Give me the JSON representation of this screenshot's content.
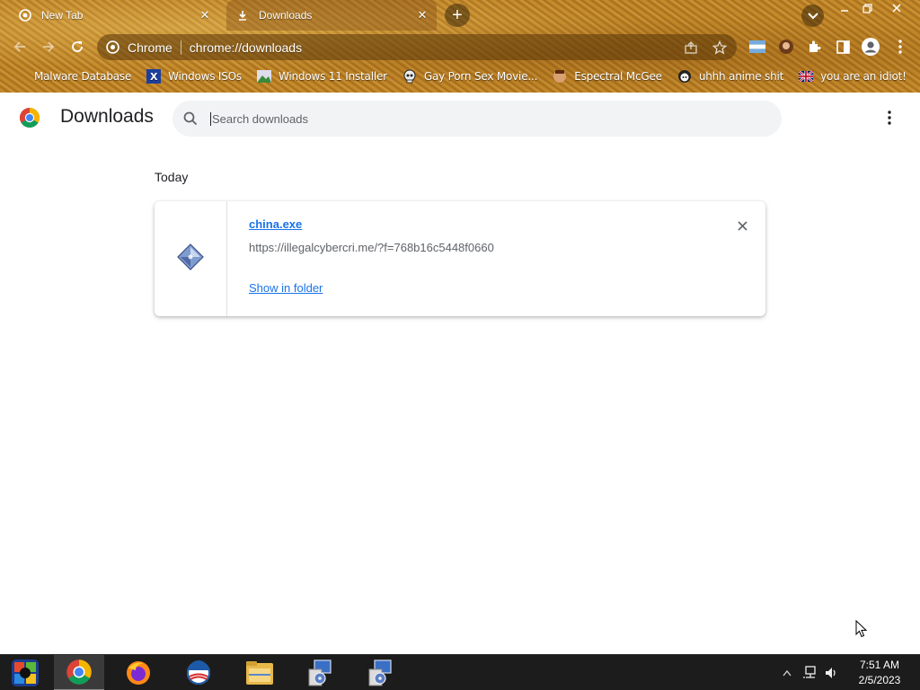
{
  "window": {
    "tabs": [
      {
        "label": "New Tab",
        "icon": "chrome-icon",
        "active": false
      },
      {
        "label": "Downloads",
        "icon": "download-icon",
        "active": true
      }
    ],
    "controls": [
      "minimize",
      "restore",
      "close"
    ]
  },
  "toolbar": {
    "omnibox_site": "Chrome",
    "omnibox_url": "chrome://downloads"
  },
  "bookmarks": [
    {
      "label": "Malware Database",
      "icon": "none"
    },
    {
      "label": "Windows ISOs",
      "icon": "x-icon"
    },
    {
      "label": "Windows 11 Installer",
      "icon": "image-icon"
    },
    {
      "label": "Gay Porn Sex Movie...",
      "icon": "skull-icon"
    },
    {
      "label": "Espectral McGee",
      "icon": "face-icon"
    },
    {
      "label": "uhhh anime shit",
      "icon": "anime-icon"
    },
    {
      "label": "you are an idiot!",
      "icon": "flag-icon"
    }
  ],
  "page": {
    "title": "Downloads",
    "search_placeholder": "Search downloads",
    "date_header": "Today",
    "downloads": [
      {
        "file_name": "china.exe",
        "url": "https://illegalcybercri.me/?f=768b16c5448f0660",
        "action": "Show in folder"
      }
    ]
  },
  "taskbar": {
    "items": [
      "start-orb",
      "chrome",
      "firefox",
      "obama-app",
      "file-explorer",
      "installer-1",
      "installer-2"
    ],
    "clock_time": "7:51 AM",
    "clock_date": "2/5/2023"
  },
  "colors": {
    "accent_link": "#1a73e8",
    "frame_theme": "#b98024",
    "taskbar": "#1c1c1c"
  }
}
